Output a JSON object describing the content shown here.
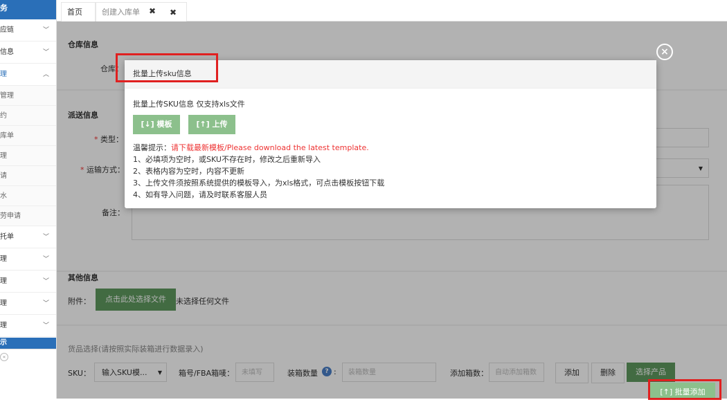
{
  "sidebar": {
    "top": "务",
    "items": [
      {
        "label": "应链",
        "chev": "﹀"
      },
      {
        "label": "信息",
        "chev": "﹀"
      },
      {
        "label": "理",
        "chev": "︿"
      }
    ],
    "subitems": [
      "管理",
      "约",
      "库单",
      "理",
      "请",
      "水",
      "劳申请"
    ],
    "items2": [
      {
        "label": "托单",
        "chev": "﹀"
      },
      {
        "label": "理",
        "chev": "﹀"
      },
      {
        "label": "理",
        "chev": "﹀"
      },
      {
        "label": "理",
        "chev": "﹀"
      },
      {
        "label": "理",
        "chev": "﹀"
      }
    ],
    "footer": "示",
    "collapse": "«"
  },
  "tabs": {
    "home": "首页",
    "create": "创建入库单",
    "close1": "✖",
    "close2": "✖"
  },
  "warehouse": {
    "title": "仓库信息",
    "label": "仓库："
  },
  "delivery": {
    "title": "派送信息",
    "type_label": "类型：",
    "transport_label": "运输方式：",
    "note_label": "备注：",
    "required": "*",
    "dropdown_arrow": "▼"
  },
  "other": {
    "title": "其他信息",
    "attachment_label": "附件：",
    "choose_file": "点击此处选择文件",
    "no_file": "未选择任何文件"
  },
  "goods": {
    "title": "货品选择(请按照实际装箱进行数据录入)",
    "sku_label": "SKU：",
    "sku_select": "输入SKU模...",
    "box_label": "箱号/FBA箱唛：",
    "box_placeholder": "未填写",
    "qty_label": "装箱数量",
    "qty_placeholder": "装箱数量",
    "add_boxes_label": "添加箱数：",
    "add_boxes_placeholder": "自动添加箱数",
    "add_btn": "添加",
    "delete_btn": "删除",
    "select_btn": "选择产品",
    "batch_btn": "批量添加",
    "batch_icon": "[↑]"
  },
  "modal": {
    "title": "批量上传sku信息",
    "desc": "批量上传SKU信息 仅支持xls文件",
    "template_btn": "模板",
    "upload_btn": "上传",
    "tip_prefix": "温馨提示：",
    "tip_red": "请下载最新模板/Please download the latest template.",
    "tips": [
      "1、必填项为空时，或SKU不存在时，修改之后重新导入",
      "2、表格内容为空时，内容不更新",
      "3、上传文件须按照系统提供的模板导入，为xls格式，可点击模板按钮下载",
      "4、如有导入问题，请及时联系客服人员"
    ],
    "close": "×"
  },
  "colors": {
    "accent": "#2a6fb8",
    "green": "#5f9a5f",
    "light_green": "#8cc08c",
    "highlight": "#e02020",
    "warning": "#e33333"
  }
}
